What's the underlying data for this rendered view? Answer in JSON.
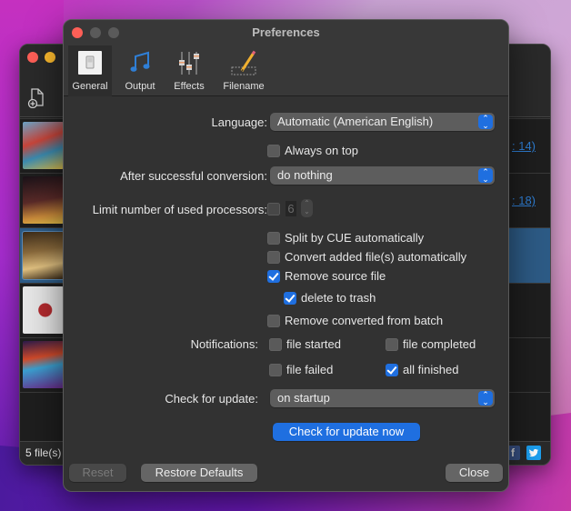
{
  "background_app": {
    "status": "5 file(s)",
    "links": [
      ": 14)",
      ": 18)"
    ],
    "albums": [
      {
        "name": "album-art-1",
        "colors": [
          "#c8453a",
          "#3b8bb0",
          "#e0c04a"
        ]
      },
      {
        "name": "album-art-2",
        "colors": [
          "#2a1a1c",
          "#c98a3a",
          "#e5c24a"
        ]
      },
      {
        "name": "album-art-3",
        "colors": [
          "#3a2a18",
          "#b48a3c",
          "#e0c080"
        ]
      },
      {
        "name": "album-art-4",
        "colors": [
          "#c8c8cc",
          "#b22a2e",
          "#e6e6e6"
        ]
      },
      {
        "name": "album-art-5",
        "colors": [
          "#2a1a4a",
          "#d04a2a",
          "#3aa0d0"
        ]
      }
    ],
    "social": {
      "facebook": "f",
      "twitter": "t"
    }
  },
  "preferences": {
    "title": "Preferences",
    "tabs": [
      {
        "label": "General",
        "icon": "switch-icon",
        "active": true
      },
      {
        "label": "Output",
        "icon": "music-note-icon",
        "active": false
      },
      {
        "label": "Effects",
        "icon": "sliders-icon",
        "active": false
      },
      {
        "label": "Filename",
        "icon": "pencil-icon",
        "active": false
      }
    ],
    "language": {
      "label": "Language:",
      "value": "Automatic (American English)"
    },
    "always_on_top": {
      "label": "Always on top",
      "checked": false
    },
    "after_conversion": {
      "label": "After successful conversion:",
      "value": "do nothing"
    },
    "processors": {
      "label": "Limit number of used processors:",
      "checked": false,
      "value": "6",
      "enabled": false
    },
    "options": [
      {
        "label": "Split by CUE automatically",
        "checked": false
      },
      {
        "label": "Convert added file(s) automatically",
        "checked": false
      },
      {
        "label": "Remove source file",
        "checked": true
      },
      {
        "label": "delete to trash",
        "checked": true
      },
      {
        "label": "Remove converted from batch",
        "checked": false
      }
    ],
    "notifications": {
      "label": "Notifications:",
      "items": [
        {
          "label": "file started",
          "checked": false
        },
        {
          "label": "file completed",
          "checked": false
        },
        {
          "label": "file failed",
          "checked": false
        },
        {
          "label": "all finished",
          "checked": true
        }
      ]
    },
    "check_update": {
      "label": "Check for update:",
      "value": "on startup",
      "button": "Check for update now"
    },
    "footer": {
      "reset": "Reset",
      "restore": "Restore Defaults",
      "close": "Close"
    },
    "colors": {
      "accent": "#1f6fe0",
      "window": "#323232",
      "close": "#fe5f57"
    }
  }
}
